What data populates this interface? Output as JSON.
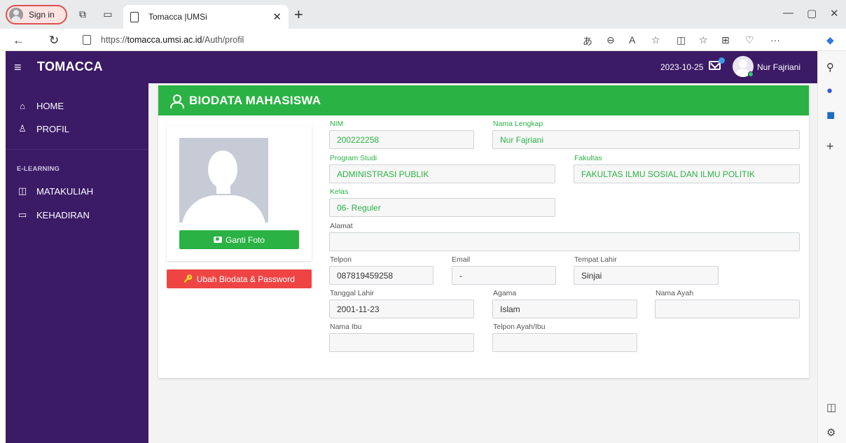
{
  "browser": {
    "signin_label": "Sign in",
    "tab_title": "Tomacca |UMSi",
    "url_prefix": "https://",
    "url_host": "tomacca.umsi.ac.id",
    "url_path": "/Auth/profil"
  },
  "header": {
    "brand": "TOMACCA",
    "date": "2023-10-25",
    "user_name": "Nur Fajriani"
  },
  "sidebar": {
    "items": [
      {
        "label": "HOME",
        "icon": "home-icon"
      },
      {
        "label": "PROFIL",
        "icon": "user-icon"
      }
    ],
    "section": "E-LEARNING",
    "learning_items": [
      {
        "label": "MATAKULIAH",
        "icon": "book-icon"
      },
      {
        "label": "KEHADIRAN",
        "icon": "monitor-icon"
      }
    ]
  },
  "card": {
    "title": "BIODATA MAHASISWA",
    "ganti_foto": "Ganti Foto",
    "ubah_biodata": "Ubah Biodata & Password"
  },
  "fields": {
    "nim": {
      "label": "NIM",
      "value": "200222258"
    },
    "nama_lengkap": {
      "label": "Nama Lengkap",
      "value": "Nur Fajriani"
    },
    "program_studi": {
      "label": "Program Studi",
      "value": "ADMINISTRASI PUBLIK"
    },
    "fakultas": {
      "label": "Fakultas",
      "value": "FAKULTAS ILMU SOSIAL DAN ILMU POLITIK"
    },
    "kelas": {
      "label": "Kelas",
      "value": "06- Reguler"
    },
    "alamat": {
      "label": "Alamat",
      "value": ""
    },
    "telpon": {
      "label": "Telpon",
      "value": "087819459258"
    },
    "email": {
      "label": "Email",
      "value": "-"
    },
    "tempat_lahir": {
      "label": "Tempat Lahir",
      "value": "Sinjai"
    },
    "tanggal_lahir": {
      "label": "Tanggal Lahir",
      "value": "2001-11-23"
    },
    "agama": {
      "label": "Agama",
      "value": "Islam"
    },
    "nama_ayah": {
      "label": "Nama Ayah",
      "value": ""
    },
    "nama_ibu": {
      "label": "Nama Ibu",
      "value": ""
    },
    "telpon_ortu": {
      "label": "Telpon Ayah/Ibu",
      "value": ""
    }
  },
  "colors": {
    "header_bg": "#3b1a66",
    "accent_green": "#2bb244",
    "danger_red": "#ef4444"
  }
}
